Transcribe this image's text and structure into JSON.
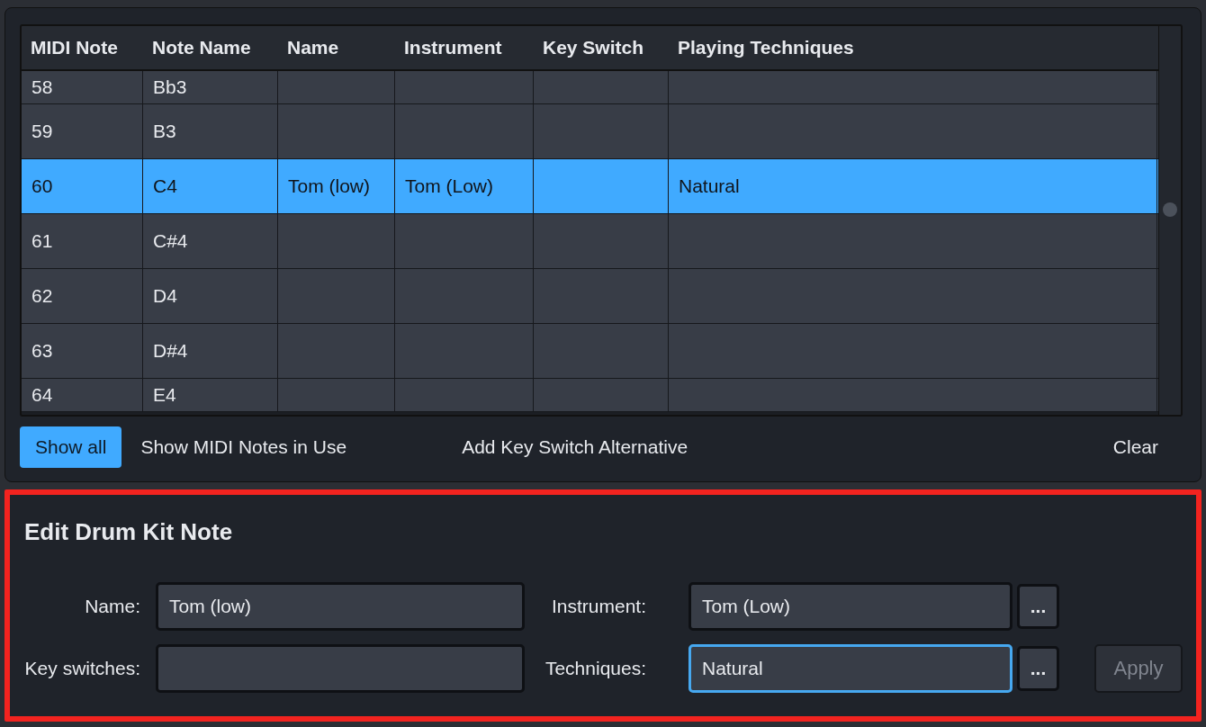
{
  "table": {
    "columns": [
      "MIDI Note",
      "Note Name",
      "Name",
      "Instrument",
      "Key Switch",
      "Playing Techniques"
    ],
    "rows": [
      {
        "cells": [
          "58",
          "Bb3",
          "",
          "",
          "",
          ""
        ],
        "selected": false,
        "partial": true
      },
      {
        "cells": [
          "59",
          "B3",
          "",
          "",
          "",
          ""
        ],
        "selected": false,
        "partial": false
      },
      {
        "cells": [
          "60",
          "C4",
          "Tom (low)",
          "Tom (Low)",
          "",
          "Natural"
        ],
        "selected": true,
        "partial": false
      },
      {
        "cells": [
          "61",
          "C#4",
          "",
          "",
          "",
          ""
        ],
        "selected": false,
        "partial": false
      },
      {
        "cells": [
          "62",
          "D4",
          "",
          "",
          "",
          ""
        ],
        "selected": false,
        "partial": false
      },
      {
        "cells": [
          "63",
          "D#4",
          "",
          "",
          "",
          ""
        ],
        "selected": false,
        "partial": false
      },
      {
        "cells": [
          "64",
          "E4",
          "",
          "",
          "",
          ""
        ],
        "selected": false,
        "partial": true
      }
    ]
  },
  "buttons": [
    {
      "label": "Show all",
      "selected": true
    },
    {
      "label": "Show MIDI Notes in Use",
      "selected": false
    },
    {
      "label": "Add Key Switch Alternative",
      "selected": false
    },
    {
      "label": "Clear",
      "selected": false
    }
  ],
  "edit_panel": {
    "title": "Edit Drum Kit Note",
    "name": {
      "label": "Name:",
      "value": "Tom (low)",
      "focused": false
    },
    "instrument": {
      "label": "Instrument:",
      "value": "Tom (Low)",
      "focused": false,
      "more": "..."
    },
    "key_switches": {
      "label": "Key switches:",
      "focused": false
    },
    "techniques": {
      "label": "Techniques:",
      "value": "Natural",
      "focused": true,
      "more": "..."
    },
    "apply": {
      "label": "Apply",
      "disabled": true
    }
  }
}
